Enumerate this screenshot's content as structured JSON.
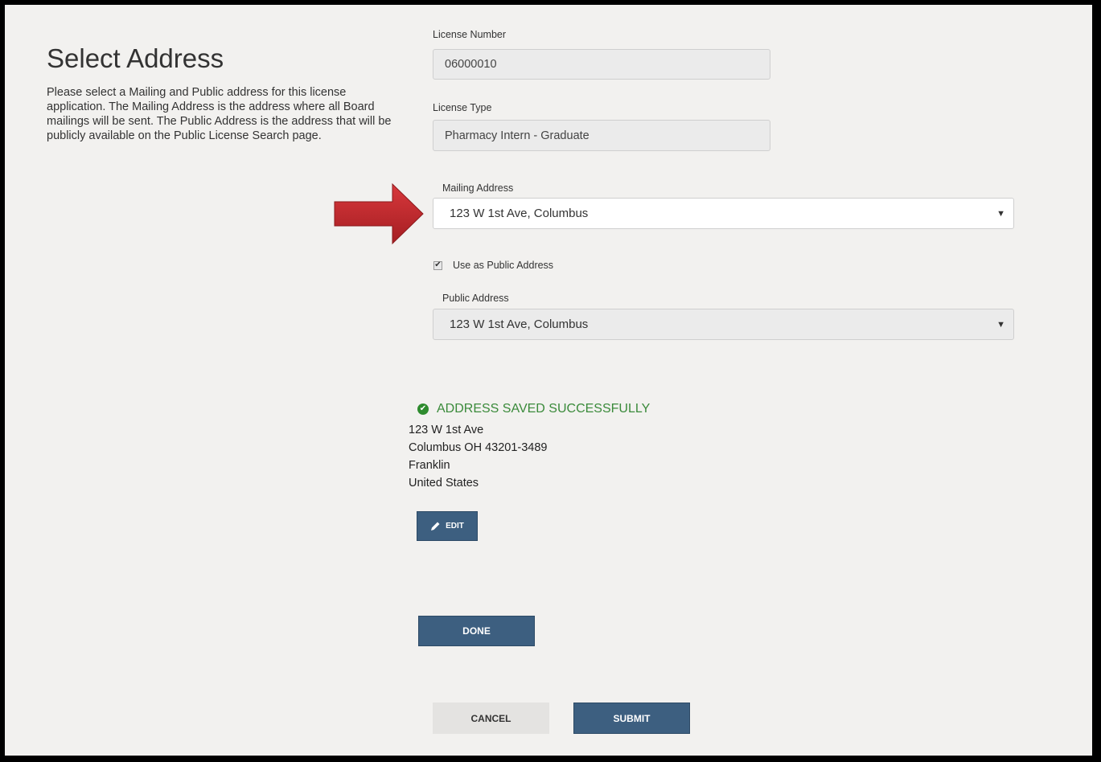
{
  "header": {
    "title": "Select Address",
    "description": "Please select a Mailing and Public address for this license application. The Mailing Address is the address where all Board mailings will be sent. The Public Address is the address that will be publicly available on the Public License Search page."
  },
  "license_number": {
    "label": "License Number",
    "value": "06000010"
  },
  "license_type": {
    "label": "License Type",
    "value": "Pharmacy Intern - Graduate"
  },
  "mailing_address": {
    "label": "Mailing Address",
    "selected": "123 W 1st Ave, Columbus"
  },
  "use_as_public": {
    "label": "Use as Public Address",
    "checked": true
  },
  "public_address": {
    "label": "Public Address",
    "selected": "123 W 1st Ave, Columbus"
  },
  "status": {
    "message": "ADDRESS SAVED SUCCESSFULLY",
    "lines": [
      "123 W 1st Ave",
      "Columbus OH 43201-3489",
      "Franklin",
      "United States"
    ],
    "color": "#3a8a3a"
  },
  "buttons": {
    "edit": "EDIT",
    "done": "DONE",
    "cancel": "CANCEL",
    "submit": "SUBMIT"
  },
  "annotation": {
    "arrow_color": "#c0272d"
  }
}
